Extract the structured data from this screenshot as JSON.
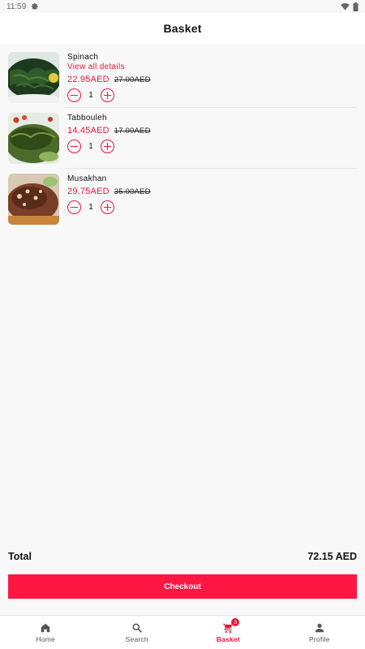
{
  "status_bar": {
    "time": "11:59",
    "settings_icon": "gear-icon",
    "wifi_icon": "wifi-icon",
    "battery_icon": "battery-icon"
  },
  "header": {
    "title": "Basket"
  },
  "basket": {
    "items": [
      {
        "name": "Spinach",
        "details_link": "View all details",
        "price": "22.95AED",
        "old_price": "27.00AED",
        "quantity": "1",
        "image_icon": "spinach-photo"
      },
      {
        "name": "Tabbouleh",
        "price": "14.45AED",
        "old_price": "17.00AED",
        "quantity": "1",
        "image_icon": "tabbouleh-photo"
      },
      {
        "name": "Musakhan",
        "price": "29.75AED",
        "old_price": "35.00AED",
        "quantity": "1",
        "image_icon": "musakhan-photo"
      }
    ]
  },
  "summary": {
    "total_label": "Total",
    "total_value": "72.15 AED"
  },
  "checkout_label": "Checkout",
  "nav": {
    "items": [
      {
        "label": "Home",
        "icon": "home-icon"
      },
      {
        "label": "Search",
        "icon": "search-icon"
      },
      {
        "label": "Basket",
        "icon": "cart-icon",
        "badge": "3",
        "active": true
      },
      {
        "label": "Profile",
        "icon": "person-icon"
      }
    ]
  },
  "colors": {
    "accent": "#e8183f",
    "checkout_bg": "#ff1744",
    "background": "#f8f8f8"
  }
}
